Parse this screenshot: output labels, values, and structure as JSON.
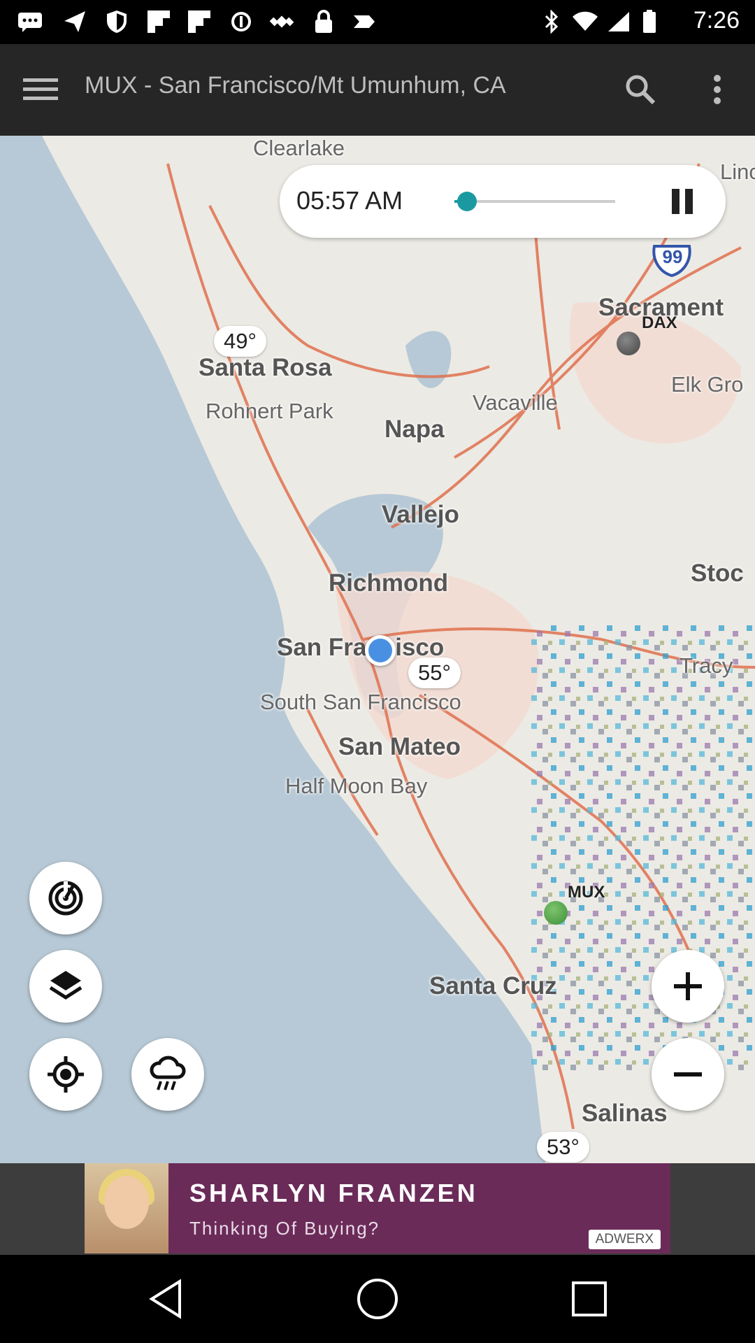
{
  "status_bar": {
    "time": "7:26",
    "icons": [
      "message-icon",
      "send-icon",
      "shield-icon",
      "flipboard-icon",
      "flipboard-icon",
      "sync-icon",
      "satellite-icon",
      "lock-icon",
      "location-icon",
      "bluetooth-icon",
      "wifi-icon",
      "signal-icon",
      "battery-icon"
    ]
  },
  "toolbar": {
    "title": "MUX - San Francisco/Mt Umunhum, CA",
    "icons": [
      "menu-icon",
      "search-icon",
      "more-vert-icon"
    ]
  },
  "playback": {
    "time": "05:57 AM",
    "progress": 0.08,
    "accent": "#1a9aa0"
  },
  "map": {
    "places": [
      {
        "name": "Clearlake",
        "size": "small"
      },
      {
        "name": "Sacrament",
        "size": "large"
      },
      {
        "name": "Elk Gro",
        "size": "small"
      },
      {
        "name": "Santa Rosa",
        "size": "large"
      },
      {
        "name": "Rohnert Park",
        "size": "small"
      },
      {
        "name": "Vacaville",
        "size": "small"
      },
      {
        "name": "Napa",
        "size": "large"
      },
      {
        "name": "Vallejo",
        "size": "large"
      },
      {
        "name": "Richmond",
        "size": "large"
      },
      {
        "name": "Stoc",
        "size": "large"
      },
      {
        "name": "San Francisco",
        "size": "large"
      },
      {
        "name": "Tracy",
        "size": "small"
      },
      {
        "name": "South San Francisco",
        "size": "small"
      },
      {
        "name": "San Mateo",
        "size": "large"
      },
      {
        "name": "Half Moon Bay",
        "size": "small"
      },
      {
        "name": "Santa Cruz",
        "size": "large"
      },
      {
        "name": "Salinas",
        "size": "large"
      },
      {
        "name": "Lincoln",
        "size": "small"
      }
    ],
    "highway": "99",
    "temperatures": [
      "49°",
      "55°",
      "53°"
    ],
    "stations": [
      {
        "name": "DAX",
        "color": "#555555"
      },
      {
        "name": "MUX",
        "color": "#3f8f3a"
      }
    ]
  },
  "controls": {
    "icons": [
      "radar-icon",
      "layers-icon",
      "my-location-icon",
      "rain-cloud-icon",
      "zoom-in-icon",
      "zoom-out-icon"
    ]
  },
  "ad": {
    "name": "SHARLYN FRANZEN",
    "tagline": "Thinking Of Buying?",
    "brand": "ADWERX"
  },
  "nav_bar": {
    "icons": [
      "back-icon",
      "home-icon",
      "recents-icon"
    ]
  }
}
